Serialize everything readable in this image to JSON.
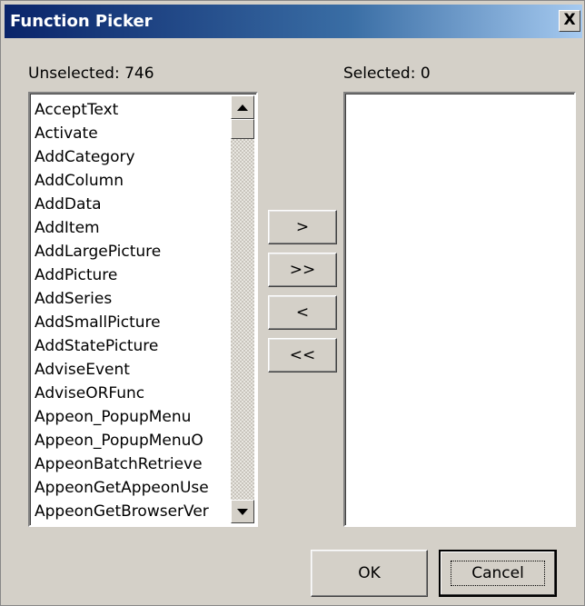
{
  "window": {
    "title": "Function Picker",
    "close_label": "X"
  },
  "unselected": {
    "label": "Unselected: 746",
    "items": [
      "AcceptText",
      "Activate",
      "AddCategory",
      "AddColumn",
      "AddData",
      "AddItem",
      "AddLargePicture",
      "AddPicture",
      "AddSeries",
      "AddSmallPicture",
      "AddStatePicture",
      "AdviseEvent",
      "AdviseORFunc",
      "Appeon_PopupMenu",
      "Appeon_PopupMenuO",
      "AppeonBatchRetrieve",
      "AppeonGetAppeonUse",
      "AppeonGetBrowserVer"
    ]
  },
  "selected": {
    "label": "Selected: 0",
    "items": []
  },
  "buttons": {
    "add": ">",
    "add_all": ">>",
    "remove": "<",
    "remove_all": "<<",
    "ok": "OK",
    "cancel": "Cancel"
  },
  "colors": {
    "dialog_bg": "#d4d0c8",
    "title_start": "#0a246a",
    "title_end": "#a6caf0"
  }
}
